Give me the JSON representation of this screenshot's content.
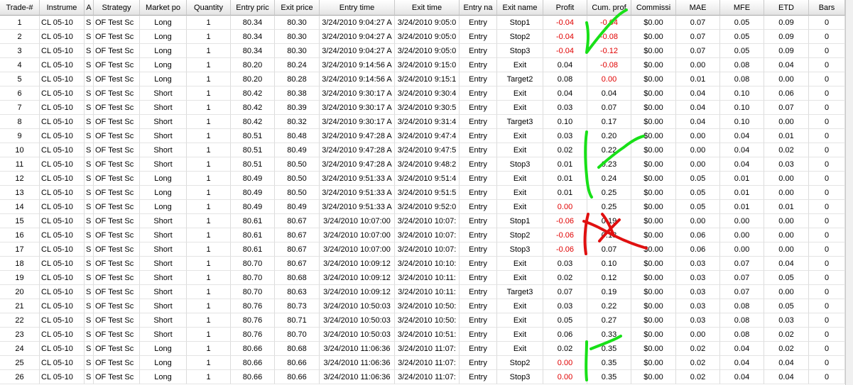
{
  "columns": [
    "Trade-#",
    "Instrume",
    "A",
    "Strategy",
    "Market po",
    "Quantity",
    "Entry pric",
    "Exit price",
    "Entry time",
    "Exit time",
    "Entry na",
    "Exit name",
    "Profit",
    "Cum. prof",
    "Commissi",
    "MAE",
    "MFE",
    "ETD",
    "Bars"
  ],
  "colors": {
    "negative": "#e00000",
    "annotation_mark": "#18e018",
    "annotation_cross": "#e01010"
  },
  "annotations": [
    {
      "icon": "green-checkmark-icon",
      "rows": "1-3"
    },
    {
      "icon": "green-checkmark-icon",
      "rows": "9-13"
    },
    {
      "icon": "red-x-mark-icon",
      "rows": "15-17"
    },
    {
      "icon": "green-checkmark-icon",
      "rows": "24-26"
    }
  ],
  "trades": [
    {
      "no": "1",
      "instrument": "CL 05-10",
      "account": "S",
      "strategy": "OF Test Sc",
      "position": "Long",
      "qty": "1",
      "entry_price": "80.34",
      "exit_price": "80.30",
      "entry_time": "3/24/2010 9:04:27 A",
      "exit_time": "3/24/2010 9:05:0",
      "entry_name": "Entry",
      "exit_name": "Stop1",
      "profit": "-0.04",
      "profit_neg": true,
      "cum": "-0.04",
      "cum_neg": true,
      "comm": "$0.00",
      "mae": "0.07",
      "mfe": "0.05",
      "etd": "0.09",
      "bars": "0"
    },
    {
      "no": "2",
      "instrument": "CL 05-10",
      "account": "S",
      "strategy": "OF Test Sc",
      "position": "Long",
      "qty": "1",
      "entry_price": "80.34",
      "exit_price": "80.30",
      "entry_time": "3/24/2010 9:04:27 A",
      "exit_time": "3/24/2010 9:05:0",
      "entry_name": "Entry",
      "exit_name": "Stop2",
      "profit": "-0.04",
      "profit_neg": true,
      "cum": "-0.08",
      "cum_neg": true,
      "comm": "$0.00",
      "mae": "0.07",
      "mfe": "0.05",
      "etd": "0.09",
      "bars": "0"
    },
    {
      "no": "3",
      "instrument": "CL 05-10",
      "account": "S",
      "strategy": "OF Test Sc",
      "position": "Long",
      "qty": "1",
      "entry_price": "80.34",
      "exit_price": "80.30",
      "entry_time": "3/24/2010 9:04:27 A",
      "exit_time": "3/24/2010 9:05:0",
      "entry_name": "Entry",
      "exit_name": "Stop3",
      "profit": "-0.04",
      "profit_neg": true,
      "cum": "-0.12",
      "cum_neg": true,
      "comm": "$0.00",
      "mae": "0.07",
      "mfe": "0.05",
      "etd": "0.09",
      "bars": "0"
    },
    {
      "no": "4",
      "instrument": "CL 05-10",
      "account": "S",
      "strategy": "OF Test Sc",
      "position": "Long",
      "qty": "1",
      "entry_price": "80.20",
      "exit_price": "80.24",
      "entry_time": "3/24/2010 9:14:56 A",
      "exit_time": "3/24/2010 9:15:0",
      "entry_name": "Entry",
      "exit_name": "Exit",
      "profit": "0.04",
      "profit_neg": false,
      "cum": "-0.08",
      "cum_neg": true,
      "comm": "$0.00",
      "mae": "0.00",
      "mfe": "0.08",
      "etd": "0.04",
      "bars": "0"
    },
    {
      "no": "5",
      "instrument": "CL 05-10",
      "account": "S",
      "strategy": "OF Test Sc",
      "position": "Long",
      "qty": "1",
      "entry_price": "80.20",
      "exit_price": "80.28",
      "entry_time": "3/24/2010 9:14:56 A",
      "exit_time": "3/24/2010 9:15:1",
      "entry_name": "Entry",
      "exit_name": "Target2",
      "profit": "0.08",
      "profit_neg": false,
      "cum": "0.00",
      "cum_neg": true,
      "comm": "$0.00",
      "mae": "0.01",
      "mfe": "0.08",
      "etd": "0.00",
      "bars": "0"
    },
    {
      "no": "6",
      "instrument": "CL 05-10",
      "account": "S",
      "strategy": "OF Test Sc",
      "position": "Short",
      "qty": "1",
      "entry_price": "80.42",
      "exit_price": "80.38",
      "entry_time": "3/24/2010 9:30:17 A",
      "exit_time": "3/24/2010 9:30:4",
      "entry_name": "Entry",
      "exit_name": "Exit",
      "profit": "0.04",
      "profit_neg": false,
      "cum": "0.04",
      "cum_neg": false,
      "comm": "$0.00",
      "mae": "0.04",
      "mfe": "0.10",
      "etd": "0.06",
      "bars": "0"
    },
    {
      "no": "7",
      "instrument": "CL 05-10",
      "account": "S",
      "strategy": "OF Test Sc",
      "position": "Short",
      "qty": "1",
      "entry_price": "80.42",
      "exit_price": "80.39",
      "entry_time": "3/24/2010 9:30:17 A",
      "exit_time": "3/24/2010 9:30:5",
      "entry_name": "Entry",
      "exit_name": "Exit",
      "profit": "0.03",
      "profit_neg": false,
      "cum": "0.07",
      "cum_neg": false,
      "comm": "$0.00",
      "mae": "0.04",
      "mfe": "0.10",
      "etd": "0.07",
      "bars": "0"
    },
    {
      "no": "8",
      "instrument": "CL 05-10",
      "account": "S",
      "strategy": "OF Test Sc",
      "position": "Short",
      "qty": "1",
      "entry_price": "80.42",
      "exit_price": "80.32",
      "entry_time": "3/24/2010 9:30:17 A",
      "exit_time": "3/24/2010 9:31:4",
      "entry_name": "Entry",
      "exit_name": "Target3",
      "profit": "0.10",
      "profit_neg": false,
      "cum": "0.17",
      "cum_neg": false,
      "comm": "$0.00",
      "mae": "0.04",
      "mfe": "0.10",
      "etd": "0.00",
      "bars": "0"
    },
    {
      "no": "9",
      "instrument": "CL 05-10",
      "account": "S",
      "strategy": "OF Test Sc",
      "position": "Short",
      "qty": "1",
      "entry_price": "80.51",
      "exit_price": "80.48",
      "entry_time": "3/24/2010 9:47:28 A",
      "exit_time": "3/24/2010 9:47:4",
      "entry_name": "Entry",
      "exit_name": "Exit",
      "profit": "0.03",
      "profit_neg": false,
      "cum": "0.20",
      "cum_neg": false,
      "comm": "$0.00",
      "mae": "0.00",
      "mfe": "0.04",
      "etd": "0.01",
      "bars": "0"
    },
    {
      "no": "10",
      "instrument": "CL 05-10",
      "account": "S",
      "strategy": "OF Test Sc",
      "position": "Short",
      "qty": "1",
      "entry_price": "80.51",
      "exit_price": "80.49",
      "entry_time": "3/24/2010 9:47:28 A",
      "exit_time": "3/24/2010 9:47:5",
      "entry_name": "Entry",
      "exit_name": "Exit",
      "profit": "0.02",
      "profit_neg": false,
      "cum": "0.22",
      "cum_neg": false,
      "comm": "$0.00",
      "mae": "0.00",
      "mfe": "0.04",
      "etd": "0.02",
      "bars": "0"
    },
    {
      "no": "11",
      "instrument": "CL 05-10",
      "account": "S",
      "strategy": "OF Test Sc",
      "position": "Short",
      "qty": "1",
      "entry_price": "80.51",
      "exit_price": "80.50",
      "entry_time": "3/24/2010 9:47:28 A",
      "exit_time": "3/24/2010 9:48:2",
      "entry_name": "Entry",
      "exit_name": "Stop3",
      "profit": "0.01",
      "profit_neg": false,
      "cum": "0.23",
      "cum_neg": false,
      "comm": "$0.00",
      "mae": "0.00",
      "mfe": "0.04",
      "etd": "0.03",
      "bars": "0"
    },
    {
      "no": "12",
      "instrument": "CL 05-10",
      "account": "S",
      "strategy": "OF Test Sc",
      "position": "Long",
      "qty": "1",
      "entry_price": "80.49",
      "exit_price": "80.50",
      "entry_time": "3/24/2010 9:51:33 A",
      "exit_time": "3/24/2010 9:51:4",
      "entry_name": "Entry",
      "exit_name": "Exit",
      "profit": "0.01",
      "profit_neg": false,
      "cum": "0.24",
      "cum_neg": false,
      "comm": "$0.00",
      "mae": "0.05",
      "mfe": "0.01",
      "etd": "0.00",
      "bars": "0"
    },
    {
      "no": "13",
      "instrument": "CL 05-10",
      "account": "S",
      "strategy": "OF Test Sc",
      "position": "Long",
      "qty": "1",
      "entry_price": "80.49",
      "exit_price": "80.50",
      "entry_time": "3/24/2010 9:51:33 A",
      "exit_time": "3/24/2010 9:51:5",
      "entry_name": "Entry",
      "exit_name": "Exit",
      "profit": "0.01",
      "profit_neg": false,
      "cum": "0.25",
      "cum_neg": false,
      "comm": "$0.00",
      "mae": "0.05",
      "mfe": "0.01",
      "etd": "0.00",
      "bars": "0"
    },
    {
      "no": "14",
      "instrument": "CL 05-10",
      "account": "S",
      "strategy": "OF Test Sc",
      "position": "Long",
      "qty": "1",
      "entry_price": "80.49",
      "exit_price": "80.49",
      "entry_time": "3/24/2010 9:51:33 A",
      "exit_time": "3/24/2010 9:52:0",
      "entry_name": "Entry",
      "exit_name": "Exit",
      "profit": "0.00",
      "profit_neg": true,
      "cum": "0.25",
      "cum_neg": false,
      "comm": "$0.00",
      "mae": "0.05",
      "mfe": "0.01",
      "etd": "0.01",
      "bars": "0"
    },
    {
      "no": "15",
      "instrument": "CL 05-10",
      "account": "S",
      "strategy": "OF Test Sc",
      "position": "Short",
      "qty": "1",
      "entry_price": "80.61",
      "exit_price": "80.67",
      "entry_time": "3/24/2010 10:07:00",
      "exit_time": "3/24/2010 10:07:",
      "entry_name": "Entry",
      "exit_name": "Stop1",
      "profit": "-0.06",
      "profit_neg": true,
      "cum": "0.19",
      "cum_neg": false,
      "comm": "$0.00",
      "mae": "0.00",
      "mfe": "0.00",
      "etd": "0.00",
      "bars": "0"
    },
    {
      "no": "16",
      "instrument": "CL 05-10",
      "account": "S",
      "strategy": "OF Test Sc",
      "position": "Short",
      "qty": "1",
      "entry_price": "80.61",
      "exit_price": "80.67",
      "entry_time": "3/24/2010 10:07:00",
      "exit_time": "3/24/2010 10:07:",
      "entry_name": "Entry",
      "exit_name": "Stop2",
      "profit": "-0.06",
      "profit_neg": true,
      "cum": "0.13",
      "cum_neg": false,
      "comm": "$0.00",
      "mae": "0.06",
      "mfe": "0.00",
      "etd": "0.00",
      "bars": "0"
    },
    {
      "no": "17",
      "instrument": "CL 05-10",
      "account": "S",
      "strategy": "OF Test Sc",
      "position": "Short",
      "qty": "1",
      "entry_price": "80.61",
      "exit_price": "80.67",
      "entry_time": "3/24/2010 10:07:00",
      "exit_time": "3/24/2010 10:07:",
      "entry_name": "Entry",
      "exit_name": "Stop3",
      "profit": "-0.06",
      "profit_neg": true,
      "cum": "0.07",
      "cum_neg": false,
      "comm": "$0.00",
      "mae": "0.06",
      "mfe": "0.00",
      "etd": "0.00",
      "bars": "0"
    },
    {
      "no": "18",
      "instrument": "CL 05-10",
      "account": "S",
      "strategy": "OF Test Sc",
      "position": "Short",
      "qty": "1",
      "entry_price": "80.70",
      "exit_price": "80.67",
      "entry_time": "3/24/2010 10:09:12",
      "exit_time": "3/24/2010 10:10:",
      "entry_name": "Entry",
      "exit_name": "Exit",
      "profit": "0.03",
      "profit_neg": false,
      "cum": "0.10",
      "cum_neg": false,
      "comm": "$0.00",
      "mae": "0.03",
      "mfe": "0.07",
      "etd": "0.04",
      "bars": "0"
    },
    {
      "no": "19",
      "instrument": "CL 05-10",
      "account": "S",
      "strategy": "OF Test Sc",
      "position": "Short",
      "qty": "1",
      "entry_price": "80.70",
      "exit_price": "80.68",
      "entry_time": "3/24/2010 10:09:12",
      "exit_time": "3/24/2010 10:11:",
      "entry_name": "Entry",
      "exit_name": "Exit",
      "profit": "0.02",
      "profit_neg": false,
      "cum": "0.12",
      "cum_neg": false,
      "comm": "$0.00",
      "mae": "0.03",
      "mfe": "0.07",
      "etd": "0.05",
      "bars": "0"
    },
    {
      "no": "20",
      "instrument": "CL 05-10",
      "account": "S",
      "strategy": "OF Test Sc",
      "position": "Short",
      "qty": "1",
      "entry_price": "80.70",
      "exit_price": "80.63",
      "entry_time": "3/24/2010 10:09:12",
      "exit_time": "3/24/2010 10:11:",
      "entry_name": "Entry",
      "exit_name": "Target3",
      "profit": "0.07",
      "profit_neg": false,
      "cum": "0.19",
      "cum_neg": false,
      "comm": "$0.00",
      "mae": "0.03",
      "mfe": "0.07",
      "etd": "0.00",
      "bars": "0"
    },
    {
      "no": "21",
      "instrument": "CL 05-10",
      "account": "S",
      "strategy": "OF Test Sc",
      "position": "Short",
      "qty": "1",
      "entry_price": "80.76",
      "exit_price": "80.73",
      "entry_time": "3/24/2010 10:50:03",
      "exit_time": "3/24/2010 10:50:",
      "entry_name": "Entry",
      "exit_name": "Exit",
      "profit": "0.03",
      "profit_neg": false,
      "cum": "0.22",
      "cum_neg": false,
      "comm": "$0.00",
      "mae": "0.03",
      "mfe": "0.08",
      "etd": "0.05",
      "bars": "0"
    },
    {
      "no": "22",
      "instrument": "CL 05-10",
      "account": "S",
      "strategy": "OF Test Sc",
      "position": "Short",
      "qty": "1",
      "entry_price": "80.76",
      "exit_price": "80.71",
      "entry_time": "3/24/2010 10:50:03",
      "exit_time": "3/24/2010 10:50:",
      "entry_name": "Entry",
      "exit_name": "Exit",
      "profit": "0.05",
      "profit_neg": false,
      "cum": "0.27",
      "cum_neg": false,
      "comm": "$0.00",
      "mae": "0.03",
      "mfe": "0.08",
      "etd": "0.03",
      "bars": "0"
    },
    {
      "no": "23",
      "instrument": "CL 05-10",
      "account": "S",
      "strategy": "OF Test Sc",
      "position": "Short",
      "qty": "1",
      "entry_price": "80.76",
      "exit_price": "80.70",
      "entry_time": "3/24/2010 10:50:03",
      "exit_time": "3/24/2010 10:51:",
      "entry_name": "Entry",
      "exit_name": "Exit",
      "profit": "0.06",
      "profit_neg": false,
      "cum": "0.33",
      "cum_neg": false,
      "comm": "$0.00",
      "mae": "0.00",
      "mfe": "0.08",
      "etd": "0.02",
      "bars": "0"
    },
    {
      "no": "24",
      "instrument": "CL 05-10",
      "account": "S",
      "strategy": "OF Test Sc",
      "position": "Long",
      "qty": "1",
      "entry_price": "80.66",
      "exit_price": "80.68",
      "entry_time": "3/24/2010 11:06:36",
      "exit_time": "3/24/2010 11:07:",
      "entry_name": "Entry",
      "exit_name": "Exit",
      "profit": "0.02",
      "profit_neg": false,
      "cum": "0.35",
      "cum_neg": false,
      "comm": "$0.00",
      "mae": "0.02",
      "mfe": "0.04",
      "etd": "0.02",
      "bars": "0"
    },
    {
      "no": "25",
      "instrument": "CL 05-10",
      "account": "S",
      "strategy": "OF Test Sc",
      "position": "Long",
      "qty": "1",
      "entry_price": "80.66",
      "exit_price": "80.66",
      "entry_time": "3/24/2010 11:06:36",
      "exit_time": "3/24/2010 11:07:",
      "entry_name": "Entry",
      "exit_name": "Stop2",
      "profit": "0.00",
      "profit_neg": true,
      "cum": "0.35",
      "cum_neg": false,
      "comm": "$0.00",
      "mae": "0.02",
      "mfe": "0.04",
      "etd": "0.04",
      "bars": "0"
    },
    {
      "no": "26",
      "instrument": "CL 05-10",
      "account": "S",
      "strategy": "OF Test Sc",
      "position": "Long",
      "qty": "1",
      "entry_price": "80.66",
      "exit_price": "80.66",
      "entry_time": "3/24/2010 11:06:36",
      "exit_time": "3/24/2010 11:07:",
      "entry_name": "Entry",
      "exit_name": "Stop3",
      "profit": "0.00",
      "profit_neg": true,
      "cum": "0.35",
      "cum_neg": false,
      "comm": "$0.00",
      "mae": "0.02",
      "mfe": "0.04",
      "etd": "0.04",
      "bars": "0"
    }
  ]
}
